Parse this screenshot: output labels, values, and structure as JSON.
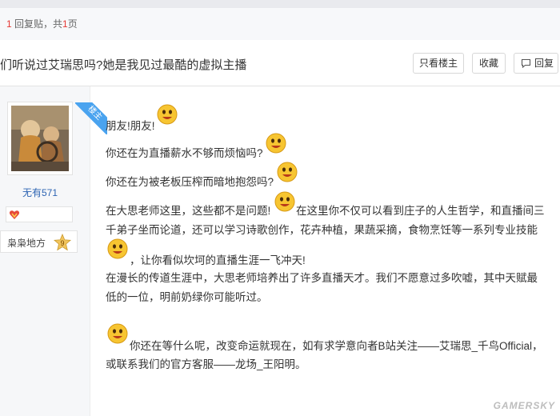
{
  "header": {
    "reply_count": "1",
    "reply_text": "回复贴，共",
    "page_count": "1",
    "page_text": "页"
  },
  "thread": {
    "title": "们听说过艾瑞思吗?她是我见过最酷的虚拟主播"
  },
  "toolbar": {
    "only_host": "只看楼主",
    "favorite": "收藏",
    "reply": "回复"
  },
  "author": {
    "host_badge": "楼主",
    "username": "无有571",
    "level_name": "枭枭地方",
    "level": "9"
  },
  "post": {
    "line1": "朋友!朋友!",
    "line2": "你还在为直播薪水不够而烦恼吗?",
    "line3": "你还在为被老板压榨而暗地抱怨吗?",
    "line4a": "在大思老师这里，这些都不是问题!",
    "line4b": "在这里你不仅可以看到庄子的人生哲学，和直播间三",
    "line5": "千弟子坐而论道，还可以学习诗歌创作，花卉种植，果蔬采摘，食物烹饪等一系列专业技能",
    "line6": "，让你看似坎坷的直播生涯一飞冲天!",
    "line7": "在漫长的传道生涯中，大思老师培养出了许多直播天才。我们不愿意过多吹嘘，其中天赋最",
    "line8": "低的一位，明前奶绿你可能听过。",
    "line9": "你还在等什么呢，改变命运就现在，如有求学意向者B站关注——艾瑞思_千鸟Official，",
    "line10": "或联系我们的官方客服——龙场_王阳明。"
  },
  "watermark": "GAMERSKY",
  "colors": {
    "accent_red": "#e53935",
    "link_blue": "#2d64b3",
    "badge_blue": "#4aa3ef",
    "emoji_yellow": "#f7c531"
  }
}
